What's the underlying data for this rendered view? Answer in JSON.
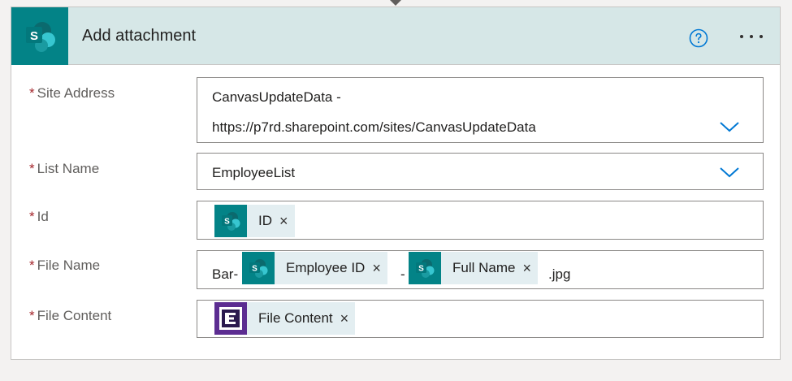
{
  "action": {
    "title": "Add attachment",
    "help_icon": "help-circle-icon",
    "more_icon": "more-options-icon",
    "brand_color": "#038387",
    "header_bg": "#d6e7e7"
  },
  "fields": {
    "required_marker": "*",
    "site_address": {
      "label": "Site Address",
      "value_line1": "CanvasUpdateData -",
      "value_line2": "https://p7rd.sharepoint.com/sites/CanvasUpdateData"
    },
    "list_name": {
      "label": "List Name",
      "value": "EmployeeList"
    },
    "id": {
      "label": "Id",
      "token_label": "ID"
    },
    "file_name": {
      "label": "File Name",
      "prefix": "Bar-",
      "token1_label": "Employee ID",
      "separator": "-",
      "token2_label": "Full Name",
      "suffix": ".jpg"
    },
    "file_content": {
      "label": "File Content",
      "token_label": "File Content"
    },
    "token_close": "×"
  }
}
